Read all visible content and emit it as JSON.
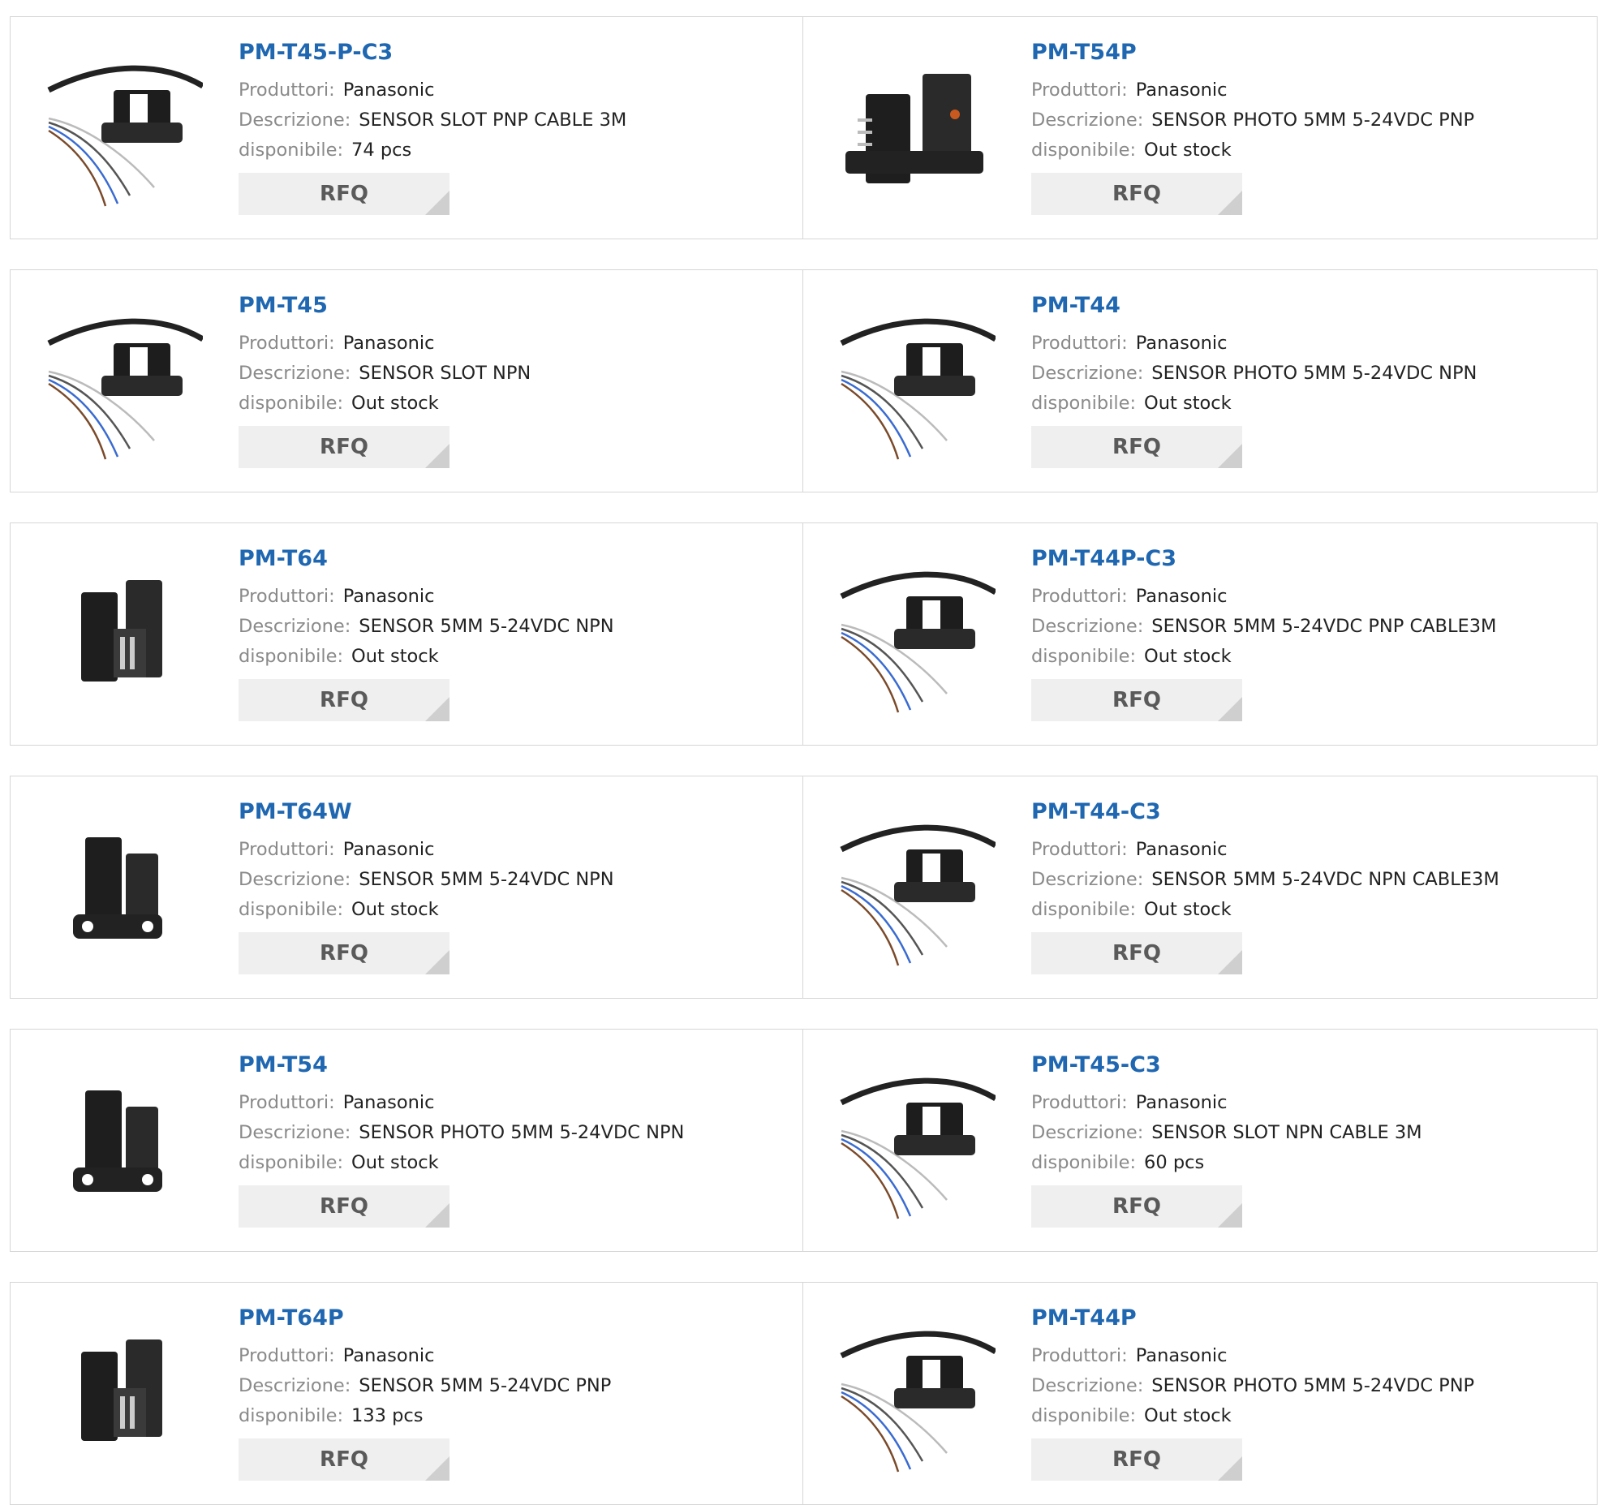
{
  "labels": {
    "manufacturer": "Produttori:",
    "description": "Descrizione:",
    "availability": "disponibile:",
    "rfq": "RFQ"
  },
  "products": [
    {
      "name": "PM-T45-P-C3",
      "manufacturer": "Panasonic",
      "description": "SENSOR SLOT PNP CABLE 3M",
      "availability": "74 pcs",
      "image": "slot-sensor-with-cable"
    },
    {
      "name": "PM-T54P",
      "manufacturer": "Panasonic",
      "description": "SENSOR PHOTO 5MM 5-24VDC PNP",
      "availability": "Out stock",
      "image": "slot-sensor-with-pins"
    },
    {
      "name": "PM-T45",
      "manufacturer": "Panasonic",
      "description": "SENSOR SLOT NPN",
      "availability": "Out stock",
      "image": "slot-sensor-with-cable"
    },
    {
      "name": "PM-T44",
      "manufacturer": "Panasonic",
      "description": "SENSOR PHOTO 5MM 5-24VDC NPN",
      "availability": "Out stock",
      "image": "slot-sensor-with-cable"
    },
    {
      "name": "PM-T64",
      "manufacturer": "Panasonic",
      "description": "SENSOR 5MM 5-24VDC NPN",
      "availability": "Out stock",
      "image": "slot-sensor-connector"
    },
    {
      "name": "PM-T44P-C3",
      "manufacturer": "Panasonic",
      "description": "SENSOR 5MM 5-24VDC PNP CABLE3M",
      "availability": "Out stock",
      "image": "slot-sensor-with-cable"
    },
    {
      "name": "PM-T64W",
      "manufacturer": "Panasonic",
      "description": "SENSOR 5MM 5-24VDC NPN",
      "availability": "Out stock",
      "image": "slot-sensor-flange"
    },
    {
      "name": "PM-T44-C3",
      "manufacturer": "Panasonic",
      "description": "SENSOR 5MM 5-24VDC NPN CABLE3M",
      "availability": "Out stock",
      "image": "slot-sensor-with-cable"
    },
    {
      "name": "PM-T54",
      "manufacturer": "Panasonic",
      "description": "SENSOR PHOTO 5MM 5-24VDC NPN",
      "availability": "Out stock",
      "image": "slot-sensor-flange"
    },
    {
      "name": "PM-T45-C3",
      "manufacturer": "Panasonic",
      "description": "SENSOR SLOT NPN CABLE 3M",
      "availability": "60 pcs",
      "image": "slot-sensor-with-cable"
    },
    {
      "name": "PM-T64P",
      "manufacturer": "Panasonic",
      "description": "SENSOR 5MM 5-24VDC PNP",
      "availability": "133 pcs",
      "image": "slot-sensor-connector"
    },
    {
      "name": "PM-T44P",
      "manufacturer": "Panasonic",
      "description": "SENSOR PHOTO 5MM 5-24VDC PNP",
      "availability": "Out stock",
      "image": "slot-sensor-with-cable"
    }
  ],
  "colors": {
    "product_link": "#1f67b1",
    "label": "#8a8a8a",
    "value": "#222222",
    "border": "#d6d6d6",
    "rfq_bg": "#efefef",
    "rfq_text": "#5a5a5a"
  }
}
